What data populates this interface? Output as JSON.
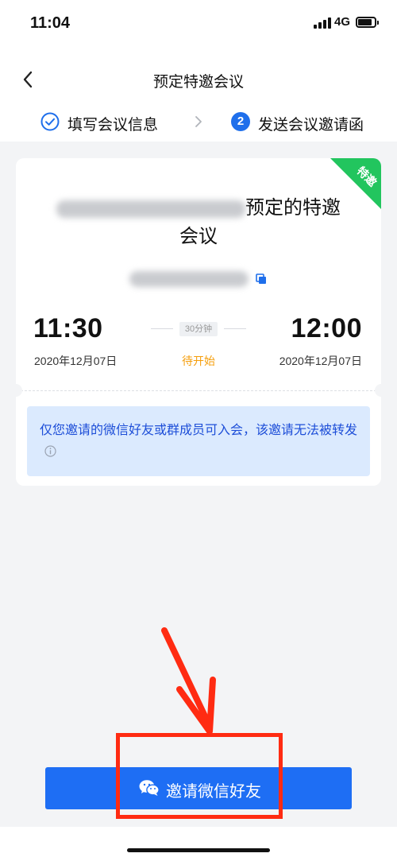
{
  "status_bar": {
    "time": "11:04",
    "network": "4G"
  },
  "nav": {
    "title": "预定特邀会议"
  },
  "steps": [
    {
      "number": "",
      "label": "填写会议信息",
      "state": "done"
    },
    {
      "number": "2",
      "label": "发送会议邀请函",
      "state": "current"
    }
  ],
  "card": {
    "ribbon": "特邀",
    "title_suffix": "预定的特邀",
    "title_line2": "会议",
    "start_time": "11:30",
    "end_time": "12:00",
    "duration": "30分钟",
    "start_date": "2020年12月07日",
    "end_date": "2020年12月07日",
    "status": "待开始",
    "notice": "仅您邀请的微信好友或群成员可入会，该邀请无法被转发"
  },
  "actions": {
    "invite_label": "邀请微信好友"
  },
  "colors": {
    "primary": "#1e6ef4",
    "ribbon": "#22c55e",
    "status": "#f59e0b",
    "annotation": "#ff2b12"
  }
}
